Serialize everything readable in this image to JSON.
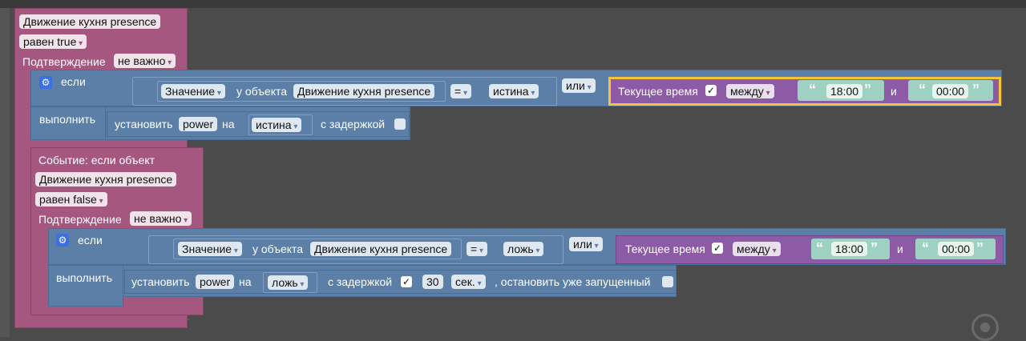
{
  "block1": {
    "object": "Движение кухня presence",
    "equals": "равен true",
    "confirm_label": "Подтверждение",
    "confirm_value": "не важно",
    "if_label": "если",
    "then_label": "выполнить",
    "value_label": "Значение",
    "of_object": "у объекта",
    "cond_object": "Движение кухня presence",
    "op": "=",
    "cond_value": "истина",
    "or": "или",
    "current_time": "Текущее время",
    "between": "между",
    "time_from": "18:00",
    "and": "и",
    "time_to": "00:00",
    "set_label": "установить",
    "set_var": "power",
    "on_label": "на",
    "set_value": "истина",
    "delay_label": "с задержкой"
  },
  "block2": {
    "event_label": "Событие: если объект",
    "object": "Движение кухня presence",
    "equals": "равен false",
    "confirm_label": "Подтверждение",
    "confirm_value": "не важно",
    "if_label": "если",
    "then_label": "выполнить",
    "value_label": "Значение",
    "of_object": "у объекта",
    "cond_object": "Движение кухня presence",
    "op": "=",
    "cond_value": "ложь",
    "or": "или",
    "current_time": "Текущее время",
    "between": "между",
    "time_from": "18:00",
    "and": "и",
    "time_to": "00:00",
    "set_label": "установить",
    "set_var": "power",
    "on_label": "на",
    "set_value": "ложь",
    "delay_label": "с задержкой",
    "delay_value": "30",
    "delay_unit": "сек.",
    "stop_label": ", остановить уже запущенный"
  },
  "icons": {
    "check": "✓",
    "gear": "⚙",
    "quote_open": "“",
    "quote_close": "”"
  }
}
